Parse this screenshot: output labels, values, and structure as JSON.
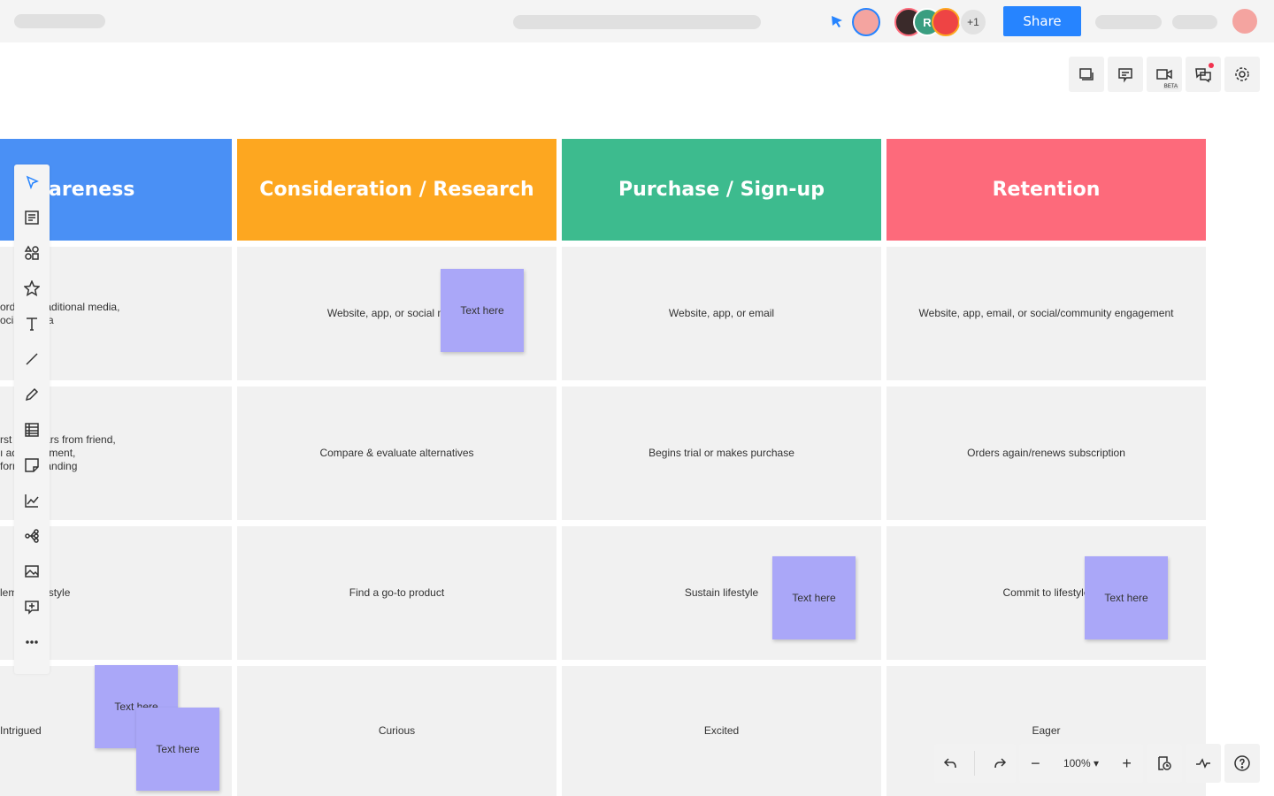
{
  "topbar": {
    "share_label": "Share",
    "collab_initial": "R",
    "extra_count": "+1"
  },
  "right_toolbar": [
    {
      "icon": "frames-icon"
    },
    {
      "icon": "comment-icon"
    },
    {
      "icon": "video-icon",
      "badge": "BETA"
    },
    {
      "icon": "chat-icon"
    },
    {
      "icon": "settings-icon"
    }
  ],
  "columns": [
    {
      "title": "areness",
      "color": "#4a90f5",
      "cells": [
        "ord          uth, traditional media,\n           ocial media",
        "rst          ter, hears from friend,\n          ı advertisement,\n          form of branding",
        "          lement lifestyle",
        "Intrigued"
      ]
    },
    {
      "title": "Consideration / Research",
      "color": "#fda720",
      "cells": [
        "Website, app, or social media",
        "Compare & evaluate alternatives",
        "Find a go-to product",
        "Curious"
      ]
    },
    {
      "title": "Purchase / Sign-up",
      "color": "#3dbb8e",
      "cells": [
        "Website, app, or email",
        "Begins trial or makes purchase",
        "Sustain lifestyle",
        "Excited"
      ]
    },
    {
      "title": "Retention",
      "color": "#fd6a7b",
      "cells": [
        "Website, app, email, or social/community engagement",
        "Orders again/renews subscription",
        "Commit to lifestyle",
        "Eager"
      ]
    }
  ],
  "stickies": [
    "Text here",
    "Text here",
    "Text here",
    "Text here",
    "Text here"
  ],
  "sticky_color": "#aaa7f8",
  "zoom": {
    "level": "100%"
  },
  "accent": "#2684ff"
}
